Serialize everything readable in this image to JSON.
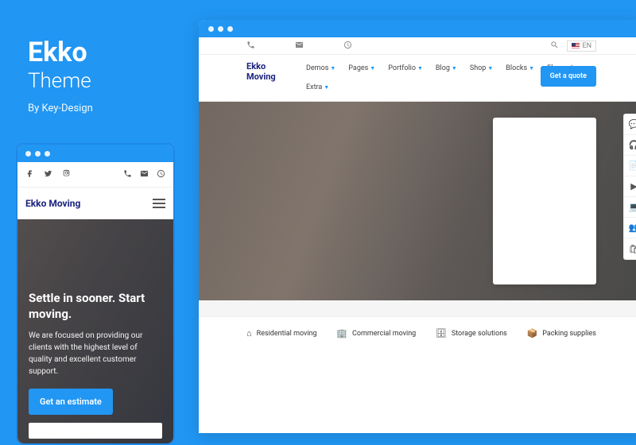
{
  "title": {
    "main": "Ekko",
    "sub": "Theme",
    "byline": "By Key-Design"
  },
  "mobile": {
    "logo": "Ekko Moving",
    "hero_heading": "Settle in sooner. Start moving.",
    "hero_text": "We are focused on providing our clients with the highest level of quality and excellent customer support.",
    "cta": "Get an estimate"
  },
  "desktop": {
    "logo": "Ekko Moving",
    "lang": "EN",
    "nav": [
      "Demos",
      "Pages",
      "Portfolio",
      "Blog",
      "Shop",
      "Blocks",
      "Elements"
    ],
    "nav2": [
      "Extra"
    ],
    "quote": "Get a quote",
    "services": [
      {
        "icon": "home",
        "label": "Residential moving"
      },
      {
        "icon": "building",
        "label": "Commercial moving"
      },
      {
        "icon": "storage",
        "label": "Storage solutions"
      },
      {
        "icon": "box",
        "label": "Packing supplies"
      }
    ]
  }
}
